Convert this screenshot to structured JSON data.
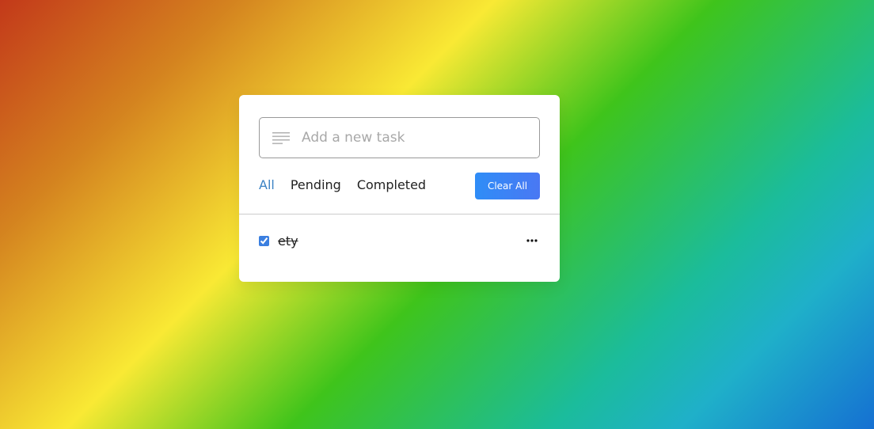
{
  "input": {
    "placeholder": "Add a new task",
    "value": "",
    "icon": "list-icon"
  },
  "filters": [
    {
      "label": "All",
      "active": true
    },
    {
      "label": "Pending",
      "active": false
    },
    {
      "label": "Completed",
      "active": false
    }
  ],
  "clear_button": {
    "label": "Clear All"
  },
  "tasks": [
    {
      "text": "ety",
      "completed": true,
      "menu_icon": "more-icon"
    }
  ],
  "colors": {
    "accent": "#3b82c4",
    "button_start": "#2f8df7",
    "button_end": "#4a78f3"
  }
}
